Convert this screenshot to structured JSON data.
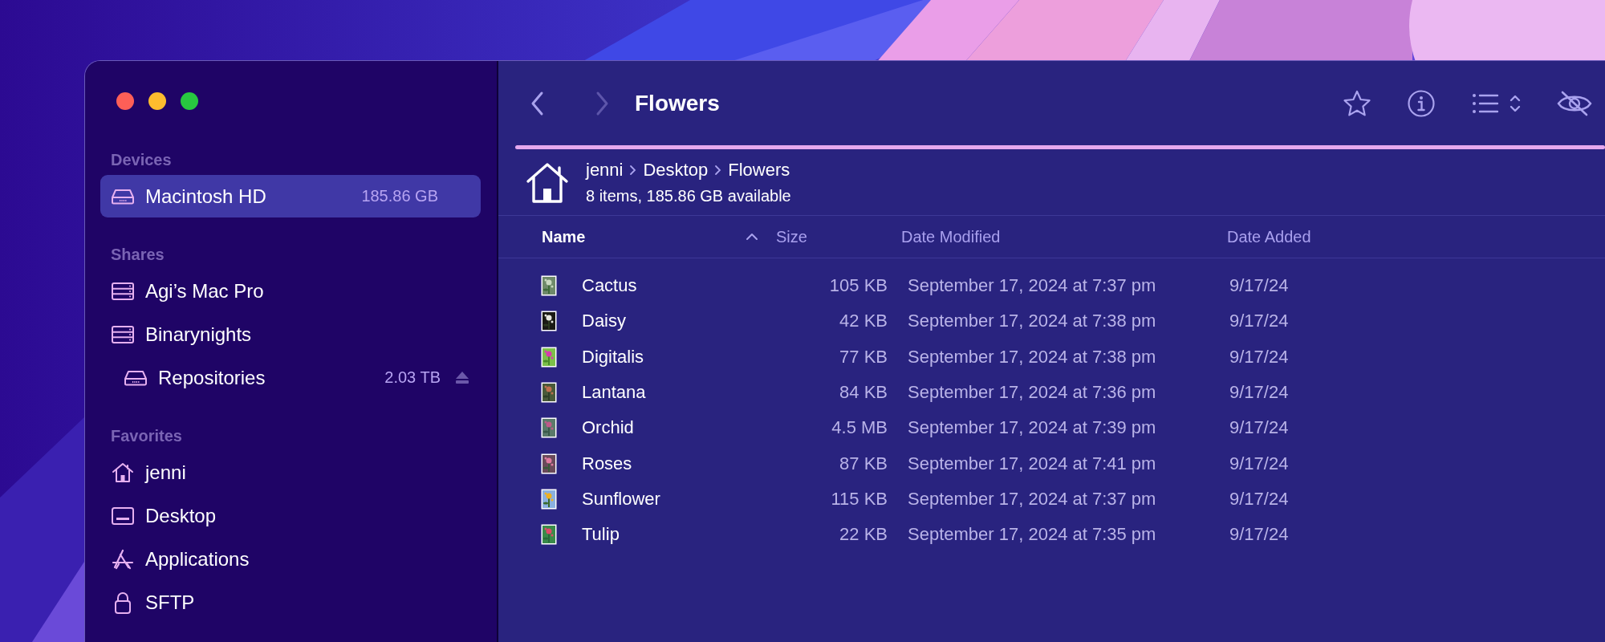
{
  "window": {
    "controls": [
      {
        "kind": "close"
      },
      {
        "kind": "minimize"
      },
      {
        "kind": "zoom"
      }
    ]
  },
  "sidebar": {
    "sections": [
      {
        "title": "Devices",
        "items": [
          {
            "label": "Macintosh HD",
            "kind": "disk",
            "detail": "185.86 GB",
            "selected": true,
            "ejectable": false
          }
        ]
      },
      {
        "title": "Shares",
        "items": [
          {
            "label": "Agi’s Mac Pro",
            "kind": "server",
            "selected": false,
            "ejectable": false
          },
          {
            "label": "Binarynights",
            "kind": "server",
            "selected": false,
            "ejectable": false,
            "children": [
              {
                "label": "Repositories",
                "kind": "disk",
                "detail": "2.03 TB",
                "selected": false,
                "ejectable": true
              }
            ]
          }
        ]
      },
      {
        "title": "Favorites",
        "items": [
          {
            "label": "jenni",
            "kind": "home",
            "selected": false,
            "ejectable": false
          },
          {
            "label": "Desktop",
            "kind": "desktop",
            "selected": false,
            "ejectable": false
          },
          {
            "label": "Applications",
            "kind": "apps",
            "selected": false,
            "ejectable": false
          },
          {
            "label": "SFTP",
            "kind": "lock",
            "selected": false,
            "ejectable": false
          }
        ]
      }
    ]
  },
  "toolbar": {
    "back": {
      "disabled": false
    },
    "forward": {
      "disabled": true
    },
    "title": "Flowers"
  },
  "path": {
    "segments": [
      "jenni",
      "Desktop",
      "Flowers"
    ],
    "status": "8 items, 185.86 GB available"
  },
  "columns": [
    {
      "label": "Name",
      "sorted": true
    },
    {
      "label": "Size",
      "sorted": false
    },
    {
      "label": "Date Modified",
      "sorted": false
    },
    {
      "label": "Date Added",
      "sorted": false
    }
  ],
  "rows": [
    {
      "name": "Cactus",
      "size": "105 KB",
      "modified": "September 17, 2024 at 7:37 pm",
      "added": "9/17/24"
    },
    {
      "name": "Daisy",
      "size": "42 KB",
      "modified": "September 17, 2024 at 7:38 pm",
      "added": "9/17/24"
    },
    {
      "name": "Digitalis",
      "size": "77 KB",
      "modified": "September 17, 2024 at 7:38 pm",
      "added": "9/17/24"
    },
    {
      "name": "Lantana",
      "size": "84 KB",
      "modified": "September 17, 2024 at 7:36 pm",
      "added": "9/17/24"
    },
    {
      "name": "Orchid",
      "size": "4.5 MB",
      "modified": "September 17, 2024 at 7:39 pm",
      "added": "9/17/24"
    },
    {
      "name": "Roses",
      "size": "87 KB",
      "modified": "September 17, 2024 at 7:41 pm",
      "added": "9/17/24"
    },
    {
      "name": "Sunflower",
      "size": "115 KB",
      "modified": "September 17, 2024 at 7:37 pm",
      "added": "9/17/24"
    },
    {
      "name": "Tulip",
      "size": "22 KB",
      "modified": "September 17, 2024 at 7:35 pm",
      "added": "9/17/24"
    }
  ]
}
